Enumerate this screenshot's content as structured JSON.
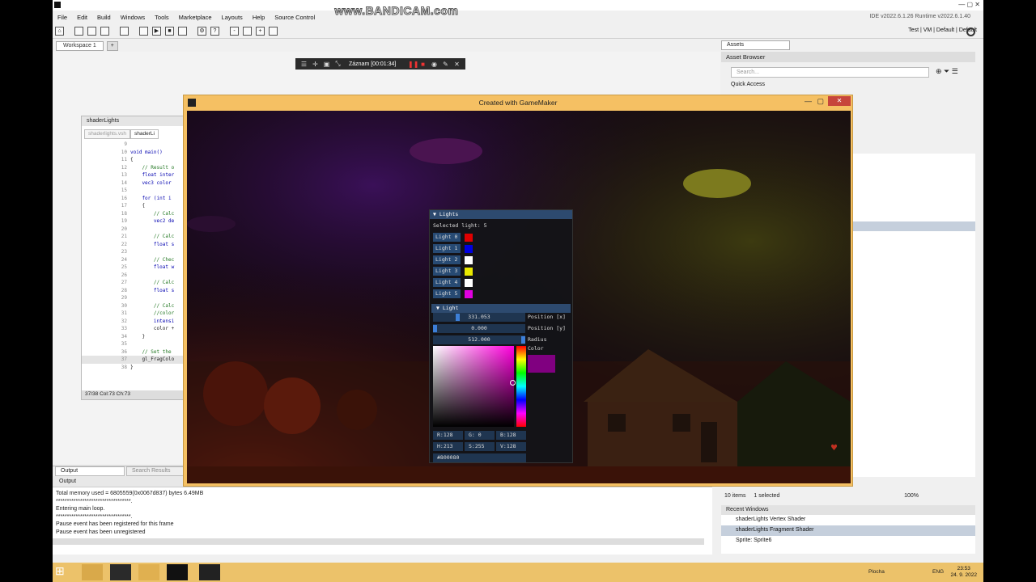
{
  "menu": [
    "File",
    "Edit",
    "Build",
    "Windows",
    "Tools",
    "Marketplace",
    "Layouts",
    "Help",
    "Source Control"
  ],
  "ide_version": "IDE v2022.6.1.26  Runtime v2022.6.1.40",
  "target_bar": "Test | VM | Default | Default",
  "workspace_tab": "Workspace 1",
  "watermark": "www.BANDICAM.com",
  "record": {
    "label": "Záznam [00:01:34]"
  },
  "code_window": {
    "title": "shaderLights",
    "tabs": [
      "shaderlights.vsh",
      "shaderLi"
    ],
    "lines": [
      {
        "n": "9",
        "t": ""
      },
      {
        "n": "10",
        "t": "void main()"
      },
      {
        "n": "11",
        "t": "{"
      },
      {
        "n": "12",
        "t": "    // Result o"
      },
      {
        "n": "13",
        "t": "    float inter"
      },
      {
        "n": "14",
        "t": "    vec3 color"
      },
      {
        "n": "15",
        "t": ""
      },
      {
        "n": "16",
        "t": "    for (int i"
      },
      {
        "n": "17",
        "t": "    {"
      },
      {
        "n": "18",
        "t": "        // Calc"
      },
      {
        "n": "19",
        "t": "        vec2 de"
      },
      {
        "n": "20",
        "t": ""
      },
      {
        "n": "21",
        "t": "        // Calc"
      },
      {
        "n": "22",
        "t": "        float s"
      },
      {
        "n": "23",
        "t": ""
      },
      {
        "n": "24",
        "t": "        // Chec"
      },
      {
        "n": "25",
        "t": "        float w"
      },
      {
        "n": "26",
        "t": ""
      },
      {
        "n": "27",
        "t": "        // Calc"
      },
      {
        "n": "28",
        "t": "        float s"
      },
      {
        "n": "29",
        "t": ""
      },
      {
        "n": "30",
        "t": "        // Calc"
      },
      {
        "n": "31",
        "t": "        //color"
      },
      {
        "n": "32",
        "t": "        intensi"
      },
      {
        "n": "33",
        "t": "        color +"
      },
      {
        "n": "34",
        "t": "    }"
      },
      {
        "n": "35",
        "t": ""
      },
      {
        "n": "36",
        "t": "    // Set the"
      },
      {
        "n": "37",
        "t": "    gl_FragColo"
      },
      {
        "n": "38",
        "t": "}"
      }
    ],
    "status": "37/38 Col:73 Ch:73"
  },
  "output": {
    "tabs": [
      "Output",
      "Search Results"
    ],
    "title": "Output",
    "lines": [
      "Total memory used = 6805559(0x0067d837) bytes 6.49MB",
      "**********************************.",
      "Entering main loop.",
      "**********************************.",
      "Pause event has been registered for this frame",
      "Pause event has been unregistered"
    ]
  },
  "assets": {
    "tab": "Assets",
    "browser": "Asset Browser",
    "search_placeholder": "Search...",
    "quick_access": "Quick Access",
    "footer_items": "10 items",
    "footer_sel": "1 selected",
    "zoom": "100%"
  },
  "recent": {
    "title": "Recent Windows",
    "items": [
      "shaderLights Vertex Shader",
      "shaderLights Fragment Shader",
      "Sprite: Sprite6"
    ]
  },
  "game_window": {
    "title": "Created with GameMaker"
  },
  "lights_panel": {
    "title": "Lights",
    "selected": "Selected light: 5",
    "lights": [
      {
        "label": "Light 0",
        "color": "#e00000"
      },
      {
        "label": "Light 1",
        "color": "#0000e0"
      },
      {
        "label": "Light 2",
        "color": "#ffffff"
      },
      {
        "label": "Light 3",
        "color": "#e8e800"
      },
      {
        "label": "Light 4",
        "color": "#ffffff"
      },
      {
        "label": "Light 5",
        "color": "#e000e0"
      }
    ],
    "sub": "Light",
    "sliders": [
      {
        "value": "331.053",
        "label": "Position [x]",
        "fraction": 0.26
      },
      {
        "value": "0.000",
        "label": "Position [y]",
        "fraction": 0.0
      },
      {
        "value": "512.000",
        "label": "Radius",
        "fraction": 1.0
      }
    ],
    "color_label": "Color",
    "swatch": "#800080",
    "rgb": [
      "R:128",
      "G:  0",
      "B:128"
    ],
    "hsv": [
      "H:213",
      "S:255",
      "V:128"
    ],
    "hex": "#800080"
  },
  "taskbar": {
    "lang": "ENG",
    "time": "23:53",
    "date": "24. 9. 2022",
    "desk": "Plocha"
  }
}
